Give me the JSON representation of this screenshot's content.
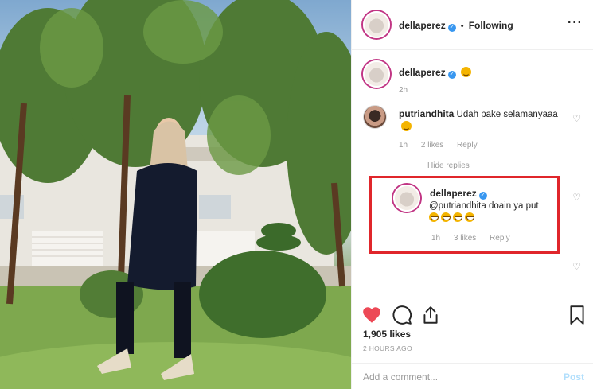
{
  "post": {
    "author": "dellaperez",
    "follow_status": "Following",
    "separator": "•",
    "more_icon": "more-horizontal-icon"
  },
  "caption": {
    "username": "dellaperez",
    "emoji": "star-struck-emoji",
    "time": "2h"
  },
  "comments": [
    {
      "username": "putriandhita",
      "text": "Udah pake selamanyaaa",
      "emoji": "heart-eyes-emoji",
      "time": "1h",
      "likes": "2 likes",
      "reply_label": "Reply"
    }
  ],
  "hide_replies": "Hide replies",
  "reply": {
    "username": "dellaperez",
    "text": "@putriandhita doain ya put",
    "emojis": [
      "grin-emoji",
      "grin-emoji",
      "grin-emoji",
      "grin-emoji"
    ],
    "time": "1h",
    "likes": "3 likes",
    "reply_label": "Reply",
    "highlight_color": "#e0262b"
  },
  "actions": {
    "like_icon": "heart-filled-icon",
    "comment_icon": "comment-icon",
    "share_icon": "share-icon",
    "save_icon": "bookmark-icon",
    "like_color": "#ed4956"
  },
  "likes_count": "1,905 likes",
  "posted_ago": "2 HOURS AGO",
  "comment_box": {
    "placeholder": "Add a comment...",
    "post_label": "Post"
  }
}
